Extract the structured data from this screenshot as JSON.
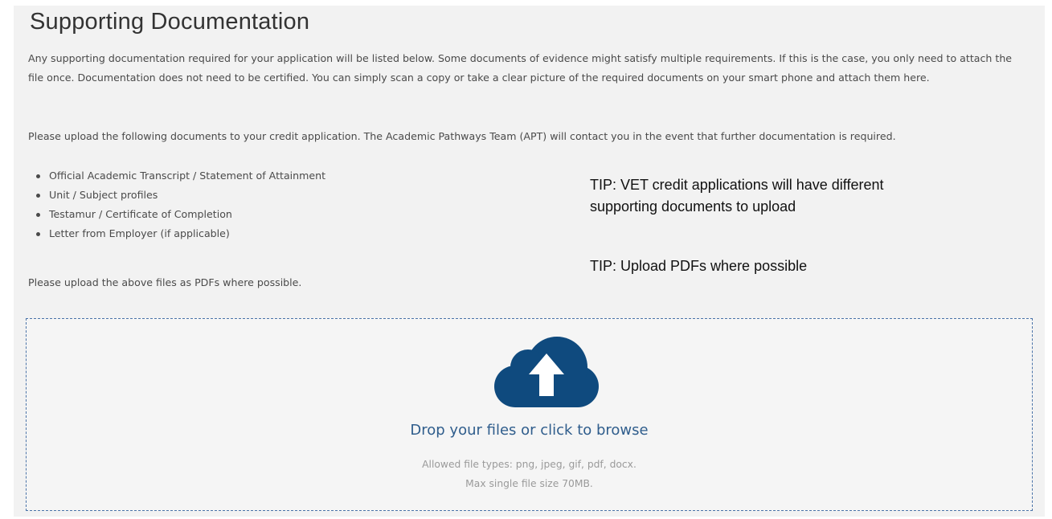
{
  "section": {
    "title": "Supporting Documentation",
    "intro": "Any supporting documentation required for your application will be listed below. Some documents of evidence might satisfy multiple requirements. If this is the case, you only need to attach the file once. Documentation does not need to be certified. You can simply scan a copy or take a clear picture of the required documents on your smart phone and attach them here.",
    "upload_instructions": "Please upload the following documents to your credit application. The Academic Pathways Team (APT) will contact you in the event that further documentation is required.",
    "documents": [
      "Official Academic Transcript / Statement of Attainment",
      "Unit / Subject profiles",
      "Testamur / Certificate of Completion",
      "Letter from Employer (if applicable)"
    ],
    "pdf_note": "Please upload the above files as PDFs where possible."
  },
  "tips": {
    "vet": "TIP: VET credit applications will have different supporting documents to upload",
    "pdf": "TIP: Upload PDFs where possible"
  },
  "dropzone": {
    "icon": "cloud-upload-icon",
    "label": "Drop your files or click to browse",
    "allowed_types": "Allowed file types: png, jpeg, gif, pdf, docx.",
    "max_size": "Max single file size 70MB.",
    "icon_color": "#0f4a7e",
    "border_color": "#4a73a8"
  }
}
